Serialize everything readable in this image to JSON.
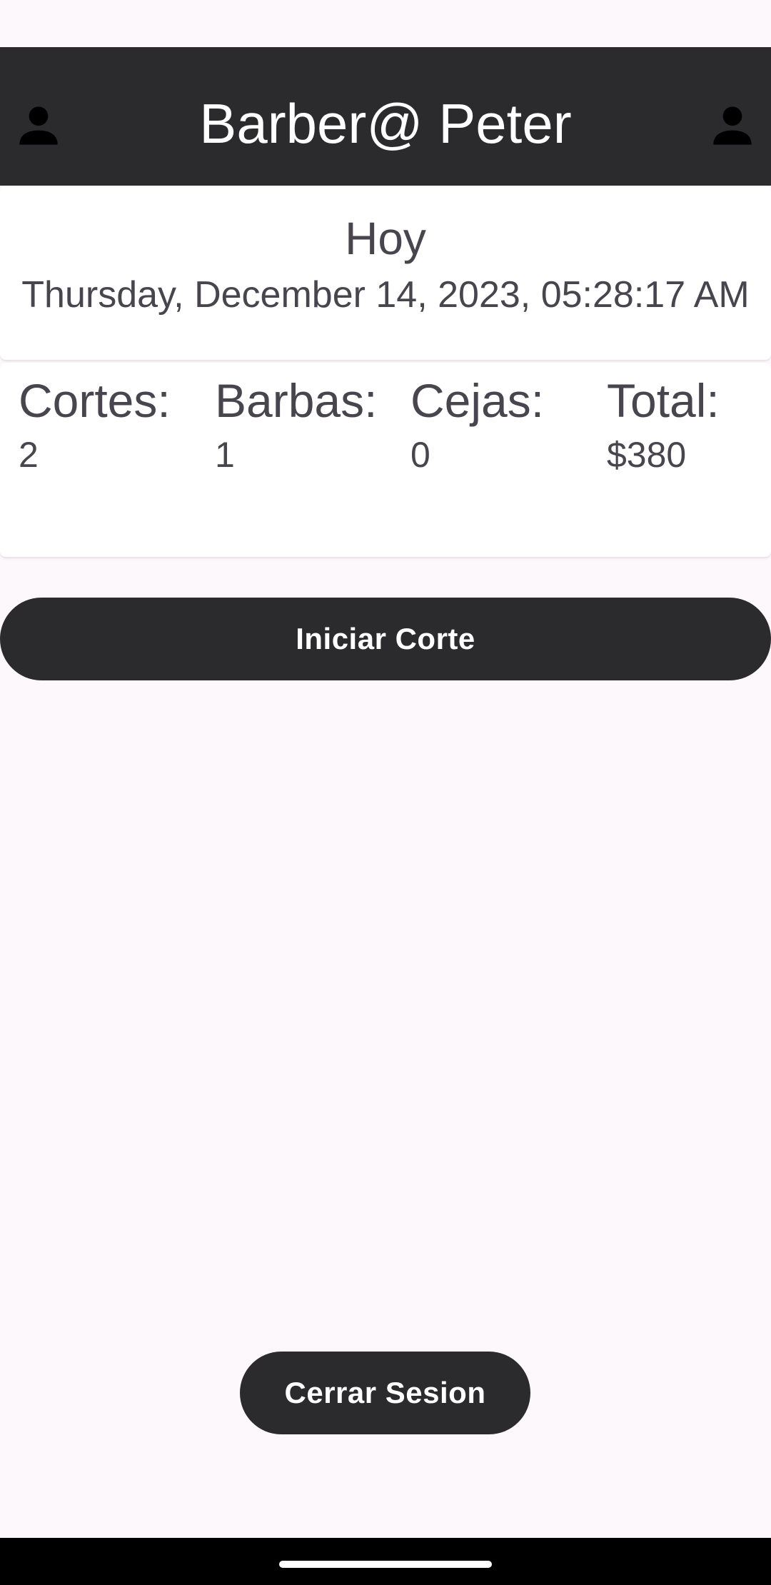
{
  "app_bar": {
    "title": "Barber@ Peter",
    "left_icon": "person-icon",
    "right_icon": "person-icon"
  },
  "today": {
    "heading": "Hoy",
    "datetime": "Thursday, December 14, 2023, 05:28:17 AM"
  },
  "stats": [
    {
      "label": "Cortes:",
      "value": "2"
    },
    {
      "label": "Barbas:",
      "value": "1"
    },
    {
      "label": "Cejas:",
      "value": "0"
    },
    {
      "label": "Total:",
      "value": "$380"
    }
  ],
  "buttons": {
    "iniciar_corte": "Iniciar Corte",
    "cerrar_sesion": "Cerrar Sesion"
  },
  "colors": {
    "app_bar_bg": "#2b2a2c",
    "page_bg": "#fdf8fc",
    "card_bg": "#ffffff",
    "text": "#48454e",
    "button_bg": "#2b2a2c",
    "button_text": "#ffffff"
  }
}
